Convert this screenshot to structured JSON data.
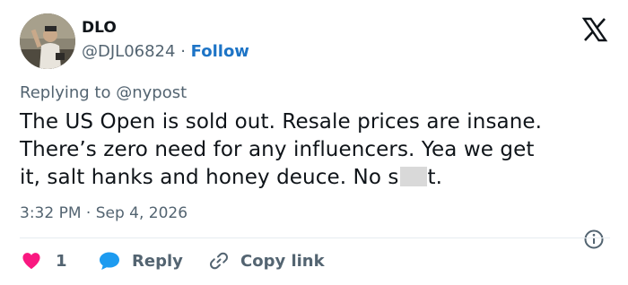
{
  "tweet": {
    "author": {
      "name": "DLO",
      "handle": "@DJL06824",
      "separator": "·",
      "follow_label": "Follow"
    },
    "replying_prefix": "Replying to",
    "replying_to": "@nypost",
    "text_line1": "The US Open is sold out. Resale prices are insane.",
    "text_line2": "There’s zero need for any influencers. Yea we get",
    "text_line3_before": "it, salt hanks and honey deuce. No s",
    "text_line3_after": "t.",
    "time": "3:32 PM",
    "date_separator": "·",
    "date": "Sep 4, 2026",
    "like_count": "1",
    "reply_label": "Reply",
    "copy_link_label": "Copy link"
  },
  "icons": {
    "brand": "x-logo-icon",
    "like": "heart-icon",
    "reply": "speech-bubble-icon",
    "copy": "link-icon",
    "info": "info-icon"
  },
  "colors": {
    "accent": "#1d74c6",
    "like": "#f91880",
    "reply_bubble": "#1d9bf0",
    "muted": "#536471",
    "text": "#0f1419"
  }
}
